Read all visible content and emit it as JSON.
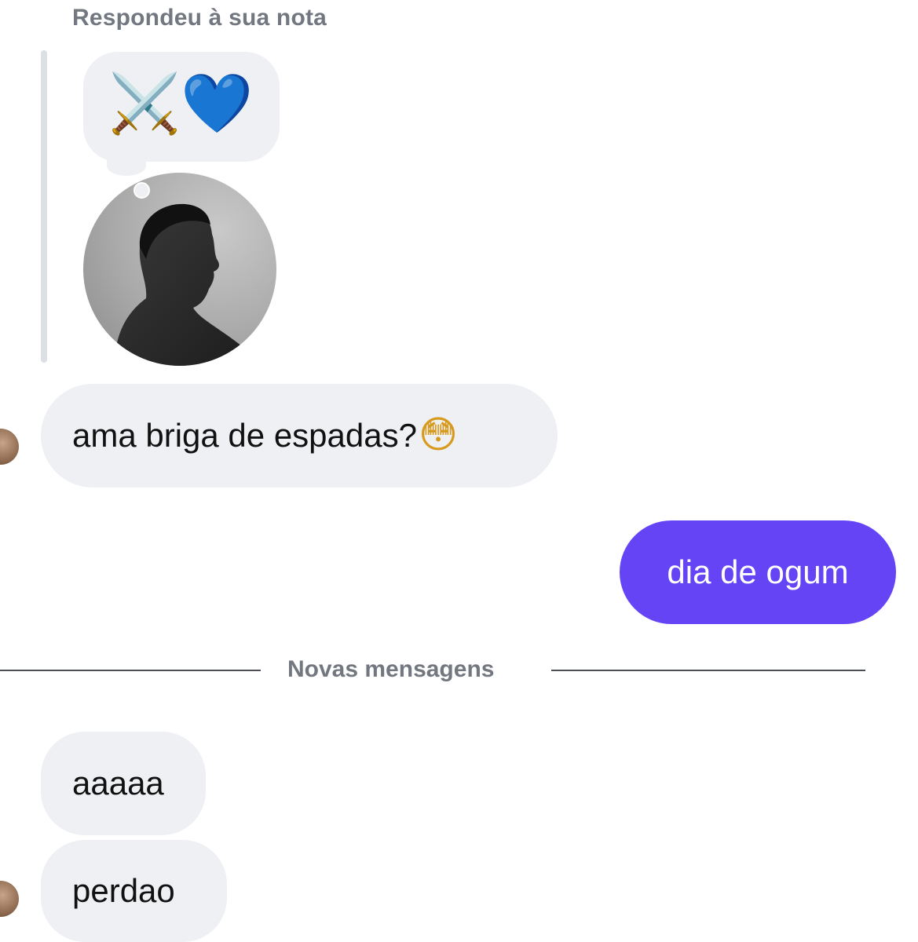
{
  "header": {
    "reply_label": "Respondeu à sua nota"
  },
  "note": {
    "emoji_swords": "⚔️",
    "emoji_heart": "💙"
  },
  "messages": [
    {
      "direction": "incoming",
      "text": "ama briga de espadas?",
      "emoji": "😳"
    },
    {
      "direction": "outgoing",
      "text": "dia de ogum"
    },
    {
      "direction": "incoming",
      "text": "aaaaa"
    },
    {
      "direction": "incoming",
      "text": "perdao"
    }
  ],
  "divider": {
    "label": "Novas mensagens"
  },
  "colors": {
    "outgoing_bubble": "#6444f4",
    "incoming_bubble": "#eef0f3",
    "meta_text": "#737880"
  }
}
